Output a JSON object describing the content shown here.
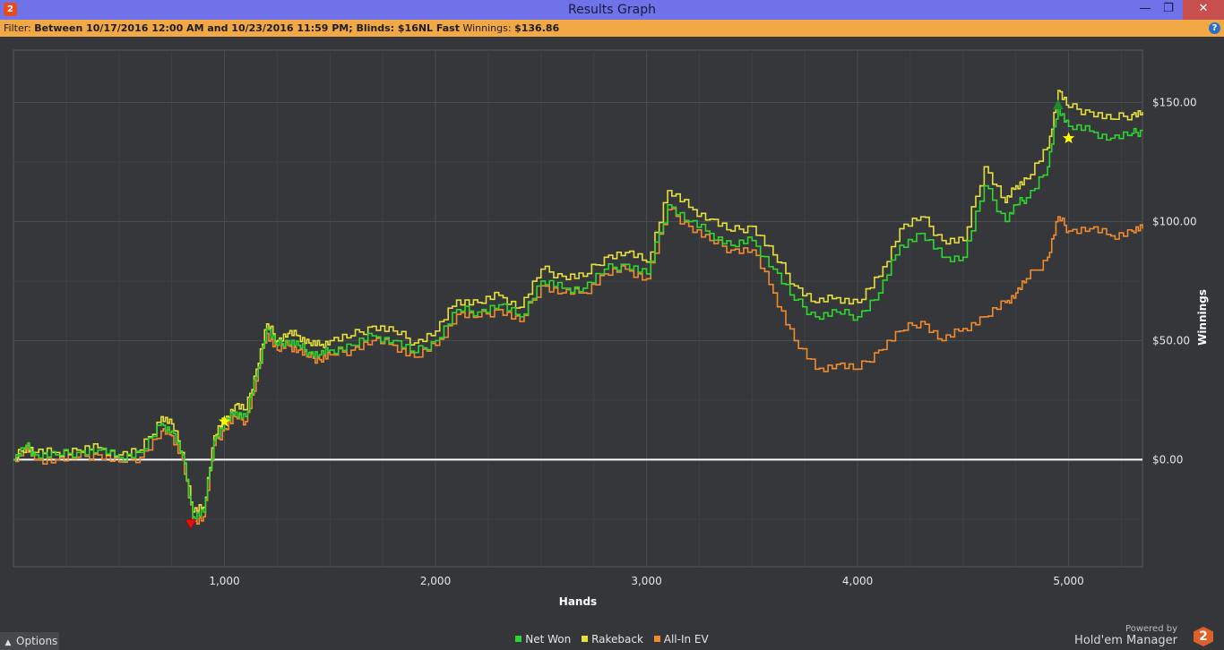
{
  "window": {
    "title": "Results Graph",
    "icon_label": "2",
    "controls": {
      "minimize": "—",
      "maximize": "❐",
      "close": "✕"
    }
  },
  "filter": {
    "label": "Filter:",
    "text": "Between 10/17/2016 12:00 AM and 10/23/2016 11:59 PM; Blinds: $16NL Fast",
    "winnings_label": "Winnings:",
    "winnings_value": "$136.86"
  },
  "options": {
    "label": "Options"
  },
  "branding": {
    "powered_by": "Powered by",
    "name": "Hold'em Manager",
    "logo": "2"
  },
  "colors": {
    "net_won": "#2fd62f",
    "rakeback": "#e6e03a",
    "allin_ev": "#f28a2e",
    "zero_line": "#ffffff",
    "grid": "#4a4d52",
    "marker_max": "#1e8a2e",
    "marker_min": "#e01010",
    "marker_star": "#ffff00"
  },
  "chart_data": {
    "type": "line",
    "xlabel": "Hands",
    "ylabel": "Winnings",
    "xlim": [
      0,
      5350
    ],
    "ylim": [
      -45,
      172
    ],
    "xticks": [
      1000,
      2000,
      3000,
      4000,
      5000
    ],
    "xtick_labels": [
      "1,000",
      "2,000",
      "3,000",
      "4,000",
      "5,000"
    ],
    "yticks": [
      0,
      50,
      100,
      150
    ],
    "ytick_labels": [
      "$0.00",
      "$50.00",
      "$100.00",
      "$150.00"
    ],
    "grid": true,
    "legend_position": "bottom-center",
    "x": [
      0,
      60,
      100,
      200,
      300,
      400,
      500,
      600,
      700,
      750,
      800,
      850,
      900,
      950,
      1000,
      1050,
      1100,
      1150,
      1200,
      1250,
      1300,
      1350,
      1400,
      1450,
      1500,
      1600,
      1700,
      1800,
      1900,
      2000,
      2100,
      2200,
      2300,
      2400,
      2500,
      2600,
      2700,
      2800,
      2900,
      3000,
      3100,
      3200,
      3300,
      3400,
      3500,
      3600,
      3700,
      3800,
      3900,
      4000,
      4100,
      4200,
      4300,
      4400,
      4500,
      4600,
      4700,
      4750,
      4800,
      4900,
      4950,
      5000,
      5100,
      5200,
      5300,
      5350
    ],
    "series": [
      {
        "name": "Net Won",
        "values": [
          0,
          6,
          2,
          2,
          3,
          4,
          1,
          3,
          15,
          12,
          2,
          -24,
          -22,
          8,
          15,
          20,
          18,
          35,
          55,
          48,
          50,
          48,
          45,
          44,
          46,
          48,
          52,
          50,
          45,
          50,
          63,
          62,
          65,
          60,
          75,
          72,
          72,
          80,
          82,
          78,
          107,
          100,
          95,
          90,
          92,
          80,
          67,
          60,
          62,
          60,
          70,
          90,
          95,
          85,
          85,
          115,
          100,
          107,
          110,
          123,
          148,
          140,
          138,
          135,
          137,
          138
        ]
      },
      {
        "name": "Rakeback",
        "values": [
          0,
          6,
          3,
          3,
          4,
          5,
          2,
          4,
          18,
          15,
          3,
          -22,
          -20,
          10,
          17,
          23,
          21,
          38,
          57,
          50,
          53,
          52,
          49,
          48,
          50,
          52,
          56,
          54,
          49,
          54,
          67,
          66,
          69,
          64,
          80,
          77,
          77,
          85,
          87,
          83,
          113,
          106,
          101,
          96,
          98,
          86,
          73,
          66,
          68,
          66,
          77,
          97,
          102,
          92,
          92,
          123,
          108,
          115,
          118,
          131,
          155,
          148,
          146,
          143,
          145,
          146
        ]
      },
      {
        "name": "All-In EV",
        "values": [
          0,
          5,
          0,
          0,
          1,
          2,
          -1,
          1,
          12,
          10,
          0,
          -26,
          -24,
          6,
          13,
          18,
          16,
          33,
          53,
          46,
          48,
          46,
          43,
          42,
          44,
          46,
          50,
          48,
          43,
          48,
          61,
          60,
          63,
          58,
          73,
          70,
          70,
          78,
          80,
          76,
          105,
          98,
          92,
          88,
          88,
          70,
          50,
          38,
          40,
          38,
          46,
          54,
          58,
          50,
          55,
          60,
          66,
          70,
          76,
          85,
          102,
          96,
          97,
          94,
          96,
          97
        ]
      }
    ],
    "markers": [
      {
        "type": "max",
        "series": "Net Won",
        "x": 4950,
        "y": 149
      },
      {
        "type": "min",
        "series": "Net Won",
        "x": 840,
        "y": -27
      },
      {
        "type": "star",
        "series": "Rakeback",
        "x": 1000,
        "y": 16
      },
      {
        "type": "star",
        "series": "Net Won",
        "x": 5000,
        "y": 135
      }
    ]
  }
}
